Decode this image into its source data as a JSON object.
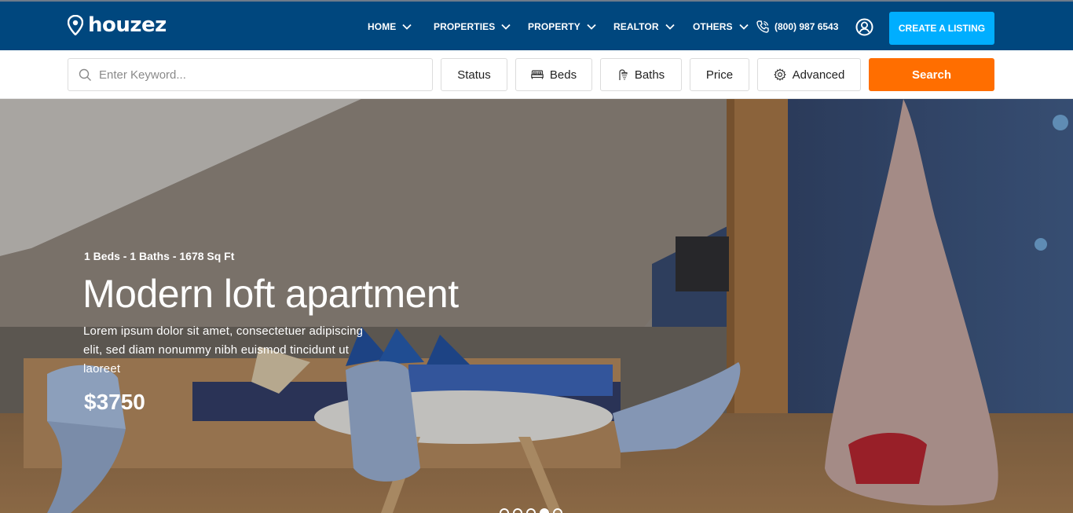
{
  "brand": {
    "name": "houzez"
  },
  "nav": {
    "items": [
      {
        "label": "HOME"
      },
      {
        "label": "PROPERTIES"
      },
      {
        "label": "PROPERTY"
      },
      {
        "label": "REALTOR"
      },
      {
        "label": "OTHERS"
      }
    ],
    "phone": "(800) 987 6543",
    "create_listing": "CREATE A LISTING"
  },
  "search": {
    "placeholder": "Enter Keyword...",
    "filters": {
      "status": "Status",
      "beds": "Beds",
      "baths": "Baths",
      "price": "Price",
      "advanced": "Advanced"
    },
    "button": "Search"
  },
  "hero": {
    "meta": "1 Beds - 1 Baths - 1678 Sq Ft",
    "title": "Modern loft apartment",
    "description": "Lorem ipsum dolor sit amet, consectetuer adipiscing elit, sed diam nonummy nibh euismod tincidunt ut laoreet",
    "price": "$3750",
    "slides": 5,
    "active_slide": 4
  },
  "colors": {
    "header_bg": "#00477e",
    "create_button": "#00aeff",
    "search_button": "#ff6e00"
  },
  "icons": [
    "pin-logo-icon",
    "chevron-down-icon",
    "phone-icon",
    "user-circle-icon",
    "search-icon",
    "bed-icon",
    "shower-icon",
    "gear-icon"
  ]
}
